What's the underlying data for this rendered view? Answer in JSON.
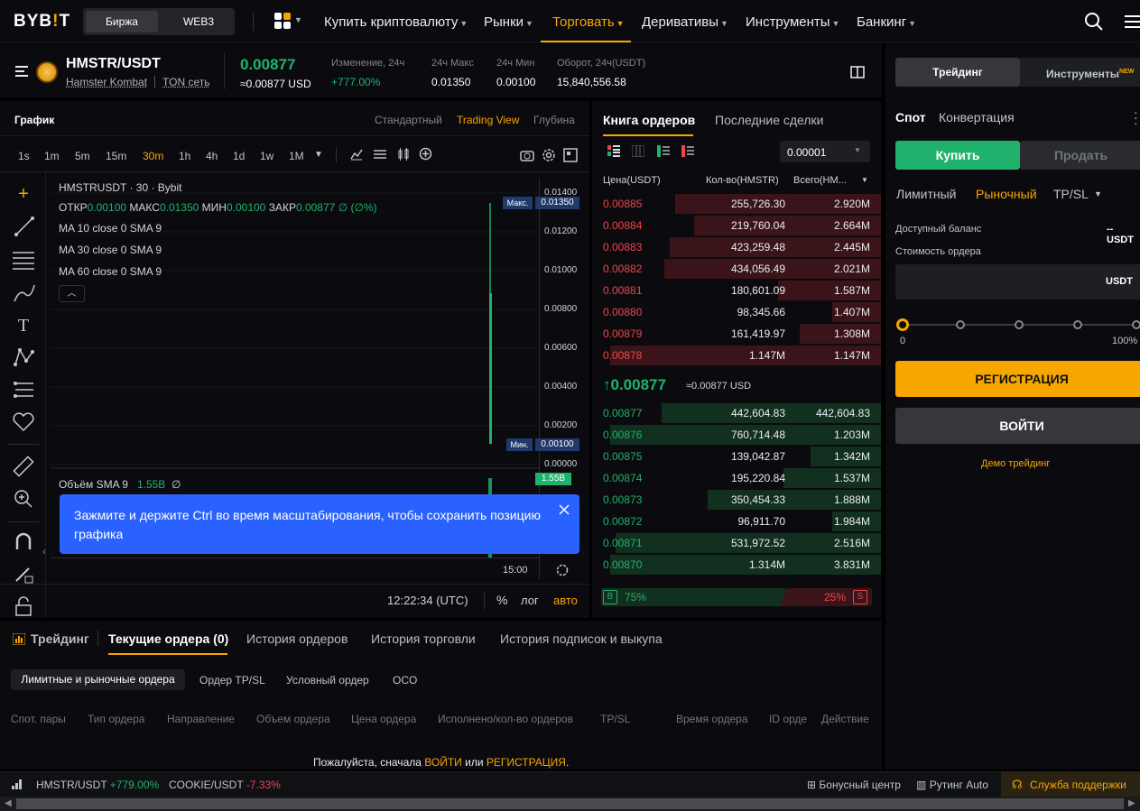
{
  "nav": {
    "logo": "BYB!T",
    "seg": [
      "Биржа",
      "WEB3"
    ],
    "items": [
      "Купить криптовалюту",
      "Рынки",
      "Торговать",
      "Деривативы",
      "Инструменты",
      "Банкинг"
    ]
  },
  "ticker": {
    "symbol": "HMSTR/USDT",
    "name": "Hamster Kombat",
    "network": "TON сеть",
    "price": "0.00877",
    "price_usd": "≈0.00877 USD",
    "change_label": "Изменение, 24ч",
    "change": "+777.00%",
    "high_label": "24ч Макс",
    "high": "0.01350",
    "low_label": "24ч Мин",
    "low": "0.00100",
    "turnover_label": "Оборот, 24ч(USDT)",
    "turnover": "15,840,556.58"
  },
  "chart": {
    "title": "График",
    "views": [
      "Стандартный",
      "Trading View",
      "Глубина"
    ],
    "intervals": [
      "1s",
      "1m",
      "5m",
      "15m",
      "30m",
      "1h",
      "4h",
      "1d",
      "1w",
      "1M"
    ],
    "active_interval": "30m",
    "legend_title": "HMSTRUSDT · 30 · Bybit",
    "ohlc": {
      "o_label": "ОТКР",
      "o": "0.00100",
      "h_label": "МАКС",
      "h": "0.01350",
      "l_label": "МИН",
      "l": "0.00100",
      "c_label": "ЗАКР",
      "c": "0.00877",
      "tail": "∅ (∅%)"
    },
    "ma": [
      "MA 10 close 0 SMA 9",
      "MA 30 close 0 SMA 9",
      "MA 60 close 0 SMA 9"
    ],
    "yticks": [
      "0.01400",
      "0.01200",
      "0.01000",
      "0.00800",
      "0.00600",
      "0.00400",
      "0.00200",
      "0.00000"
    ],
    "max_label": "Макс.",
    "max_value": "0.01350",
    "min_label": "Мин.",
    "min_value": "0.00100",
    "volume_label": "Объём SMA 9",
    "volume_value": "1.55B",
    "volume_tag": "1.55B",
    "volume_tail": "∅",
    "time_tick": "15:00",
    "clock": "12:22:34 (UTC)",
    "pct": "%",
    "log": "лог",
    "auto": "авто",
    "toast": "Зажмите и держите Ctrl во время масштабирования, чтобы сохранить позицию графика"
  },
  "orderbook": {
    "tabs": [
      "Книга ордеров",
      "Последние сделки"
    ],
    "precision": "0.00001",
    "headers": [
      "Цена(USDT)",
      "Кол-во(HMSTR)",
      "Всего(HM..."
    ],
    "asks": [
      {
        "p": "0.00885",
        "q": "255,726.30",
        "t": "2.920M",
        "d": 0.76
      },
      {
        "p": "0.00884",
        "q": "219,760.04",
        "t": "2.664M",
        "d": 0.69
      },
      {
        "p": "0.00883",
        "q": "423,259.48",
        "t": "2.445M",
        "d": 0.78
      },
      {
        "p": "0.00882",
        "q": "434,056.49",
        "t": "2.021M",
        "d": 0.8
      },
      {
        "p": "0.00881",
        "q": "180,601.09",
        "t": "1.587M",
        "d": 0.38
      },
      {
        "p": "0.00880",
        "q": "98,345.66",
        "t": "1.407M",
        "d": 0.18
      },
      {
        "p": "0.00879",
        "q": "161,419.97",
        "t": "1.308M",
        "d": 0.3
      },
      {
        "p": "0.00878",
        "q": "1.147M",
        "t": "1.147M",
        "d": 1.0
      }
    ],
    "mid_price": "0.00877",
    "mid_usd": "≈0.00877 USD",
    "bids": [
      {
        "p": "0.00877",
        "q": "442,604.83",
        "t": "442,604.83",
        "d": 0.81
      },
      {
        "p": "0.00876",
        "q": "760,714.48",
        "t": "1.203M",
        "d": 1.0
      },
      {
        "p": "0.00875",
        "q": "139,042.87",
        "t": "1.342M",
        "d": 0.26
      },
      {
        "p": "0.00874",
        "q": "195,220.84",
        "t": "1.537M",
        "d": 0.36
      },
      {
        "p": "0.00873",
        "q": "350,454.33",
        "t": "1.888M",
        "d": 0.64
      },
      {
        "p": "0.00872",
        "q": "96,911.70",
        "t": "1.984M",
        "d": 0.18
      },
      {
        "p": "0.00871",
        "q": "531,972.52",
        "t": "2.516M",
        "d": 0.98
      },
      {
        "p": "0.00870",
        "q": "1.314M",
        "t": "3.831M",
        "d": 1.0
      }
    ],
    "buy_label": "B",
    "buy_pct": "75%",
    "sell_pct": "25%",
    "sell_label": "S"
  },
  "trade": {
    "tabs": [
      "Трейдинг",
      "Инструменты"
    ],
    "new": "NEW",
    "modes": [
      "Спот",
      "Конвертация"
    ],
    "buy": "Купить",
    "sell": "Продать",
    "types": [
      "Лимитный",
      "Рыночный",
      "TP/SL"
    ],
    "balance_label": "Доступный баланс",
    "balance": "-- USDT",
    "cost_label": "Стоимость ордера",
    "cost_unit": "USDT",
    "slider_min": "0",
    "slider_max": "100%",
    "register": "РЕГИСТРАЦИЯ",
    "login": "ВОЙТИ",
    "demo": "Демо трейдинг"
  },
  "bottom": {
    "title": "Трейдинг",
    "tabs": [
      "Текущие ордера (0)",
      "История ордеров",
      "История торговли",
      "История подписок и выкупа"
    ],
    "subtabs": [
      "Лимитные и рыночные ордера",
      "Ордер TP/SL",
      "Условный ордер",
      "OCO"
    ],
    "columns": [
      "Спот. пары",
      "Тип ордера",
      "Направление",
      "Объем ордера",
      "Цена ордера",
      "Исполнено/кол-во ордеров",
      "TP/SL",
      "Время ордера",
      "ID орде",
      "Действие"
    ],
    "prompt_a": "Пожалуйста, сначала ",
    "prompt_login": "ВОЙТИ",
    "prompt_or": " или ",
    "prompt_reg": "РЕГИСТРАЦИЯ",
    "prompt_end": "."
  },
  "status": {
    "pair1": "HMSTR/USDT",
    "chg1": "+779.00%",
    "pair2": "COOKIE/USDT",
    "chg2": "-7.33%",
    "bonus": "Бонусный центр",
    "routine": "Рутинг Auto",
    "support": "Служба поддержки"
  }
}
